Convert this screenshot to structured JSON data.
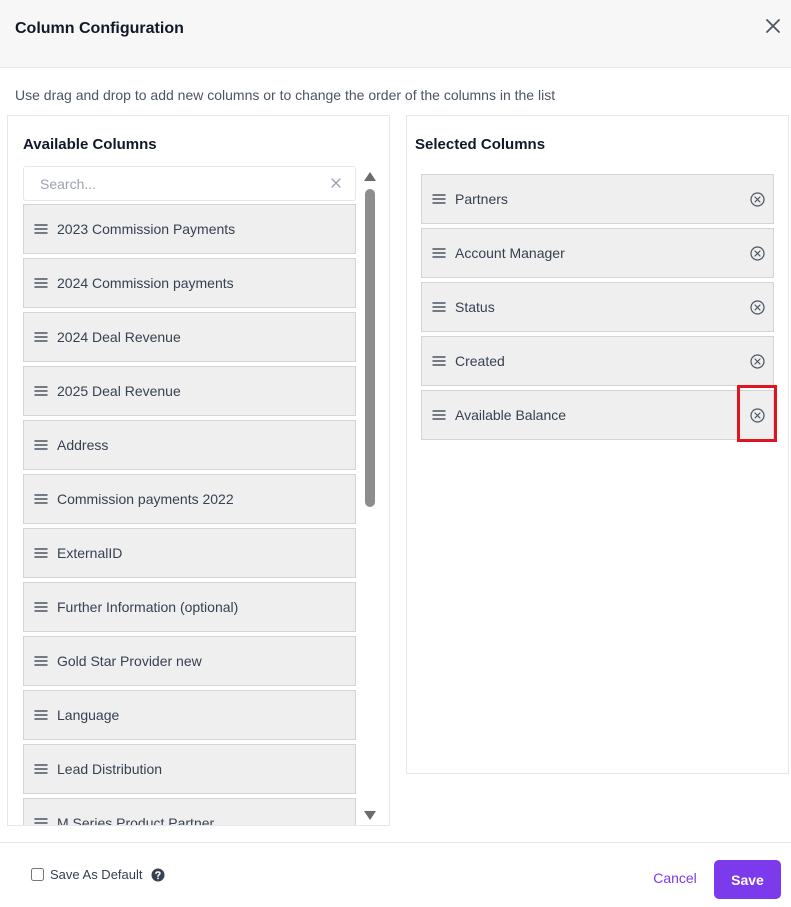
{
  "dialog": {
    "title": "Column Configuration",
    "instructions": "Use drag and drop to add new columns or to change the order of the columns in the list"
  },
  "available": {
    "heading": "Available Columns",
    "search_placeholder": "Search...",
    "items": [
      {
        "label": "2023 Commission Payments"
      },
      {
        "label": "2024 Commission payments"
      },
      {
        "label": "2024 Deal Revenue"
      },
      {
        "label": "2025 Deal Revenue"
      },
      {
        "label": "Address"
      },
      {
        "label": "Commission payments 2022"
      },
      {
        "label": "ExternalID"
      },
      {
        "label": "Further Information (optional)"
      },
      {
        "label": "Gold Star Provider new"
      },
      {
        "label": "Language"
      },
      {
        "label": "Lead Distribution"
      },
      {
        "label": "M Series Product Partner"
      }
    ]
  },
  "selected": {
    "heading": "Selected Columns",
    "items": [
      {
        "label": "Partners"
      },
      {
        "label": "Account Manager"
      },
      {
        "label": "Status"
      },
      {
        "label": "Created"
      },
      {
        "label": "Available Balance"
      }
    ]
  },
  "footer": {
    "save_default_label": "Save As Default",
    "cancel_label": "Cancel",
    "save_label": "Save"
  },
  "colors": {
    "accent": "#7c3aed",
    "highlight": "#e0141e",
    "item_bg": "#efefef"
  },
  "icons": {
    "close": "close-icon",
    "drag": "drag-handle-icon",
    "remove": "remove-circle-icon",
    "help": "question-circle-icon"
  }
}
